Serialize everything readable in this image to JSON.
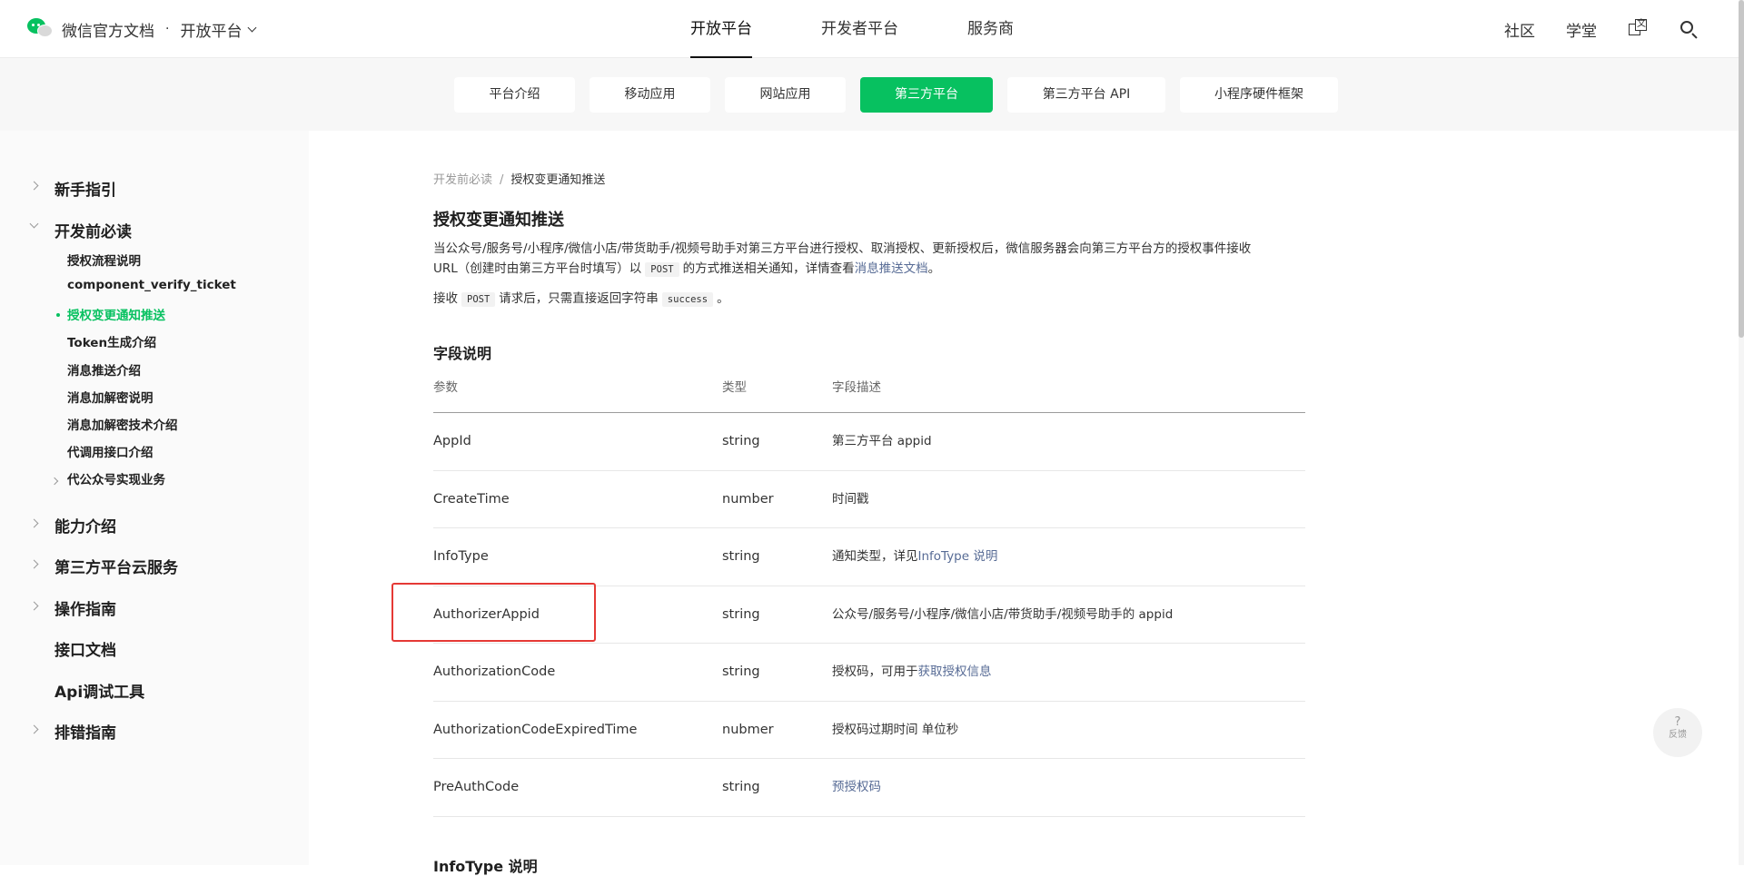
{
  "header": {
    "brand": "微信官方文档",
    "separator": "·",
    "platform": "开放平台",
    "main_tabs": [
      "开放平台",
      "开发者平台",
      "服务商"
    ],
    "right_links": [
      "社区",
      "学堂"
    ]
  },
  "subnav": {
    "tabs": [
      "平台介绍",
      "移动应用",
      "网站应用",
      "第三方平台",
      "第三方平台 API",
      "小程序硬件框架"
    ],
    "active": "第三方平台"
  },
  "sidebar": {
    "items": [
      {
        "label": "新手指引"
      },
      {
        "label": "开发前必读"
      },
      {
        "label": "授权流程说明"
      },
      {
        "label": "component_verify_ticket"
      },
      {
        "label": "授权变更通知推送"
      },
      {
        "label": "Token生成介绍"
      },
      {
        "label": "消息推送介绍"
      },
      {
        "label": "消息加解密说明"
      },
      {
        "label": "消息加解密技术介绍"
      },
      {
        "label": "代调用接口介绍"
      },
      {
        "label": "代公众号实现业务"
      },
      {
        "label": "能力介绍"
      },
      {
        "label": "第三方平台云服务"
      },
      {
        "label": "操作指南"
      },
      {
        "label": "接口文档"
      },
      {
        "label": "Api调试工具"
      },
      {
        "label": "排错指南"
      }
    ]
  },
  "content": {
    "breadcrumb": [
      "开发前必读",
      "/",
      "授权变更通知推送"
    ],
    "title": "授权变更通知推送",
    "intro_line1": "当公众号/服务号/小程序/微信小店/带货助手/视频号助手对第三方平台进行授权、取消授权、更新授权后，微信服务器会向第三方平台方的授权事件接收",
    "intro_line2_a": "URL（创建时由第三方平台时填写）以",
    "intro_code1": "POST",
    "intro_line2_b": "的方式推送相关通知，详情查看",
    "intro_link": "消息推送文档",
    "intro_line2_c": "。",
    "reply_a": "接收",
    "reply_code1": "POST",
    "reply_b": "请求后，只需直接返回字符串",
    "reply_code2": "success",
    "reply_c": "。",
    "section_title": "字段说明",
    "table": {
      "headers": [
        "参数",
        "类型",
        "字段描述"
      ],
      "rows": [
        {
          "param": "AppId",
          "type": "string",
          "desc": "第三方平台 appid",
          "link": ""
        },
        {
          "param": "CreateTime",
          "type": "number",
          "desc": "时间戳",
          "link": ""
        },
        {
          "param": "InfoType",
          "type": "string",
          "desc": "通知类型，详见",
          "link": "InfoType 说明"
        },
        {
          "param": "AuthorizerAppid",
          "type": "string",
          "desc": "公众号/服务号/小程序/微信小店/带货助手/视频号助手的 appid",
          "link": ""
        },
        {
          "param": "AuthorizationCode",
          "type": "string",
          "desc": "授权码，可用于",
          "link": "获取授权信息"
        },
        {
          "param": "AuthorizationCodeExpiredTime",
          "type": "nubmer",
          "desc": "授权码过期时间 单位秒",
          "link": ""
        },
        {
          "param": "PreAuthCode",
          "type": "string",
          "desc": "",
          "link": "预授权码"
        }
      ]
    },
    "next_heading": "InfoType 说明"
  },
  "feedback": {
    "symbol": "?",
    "label": "反馈"
  }
}
